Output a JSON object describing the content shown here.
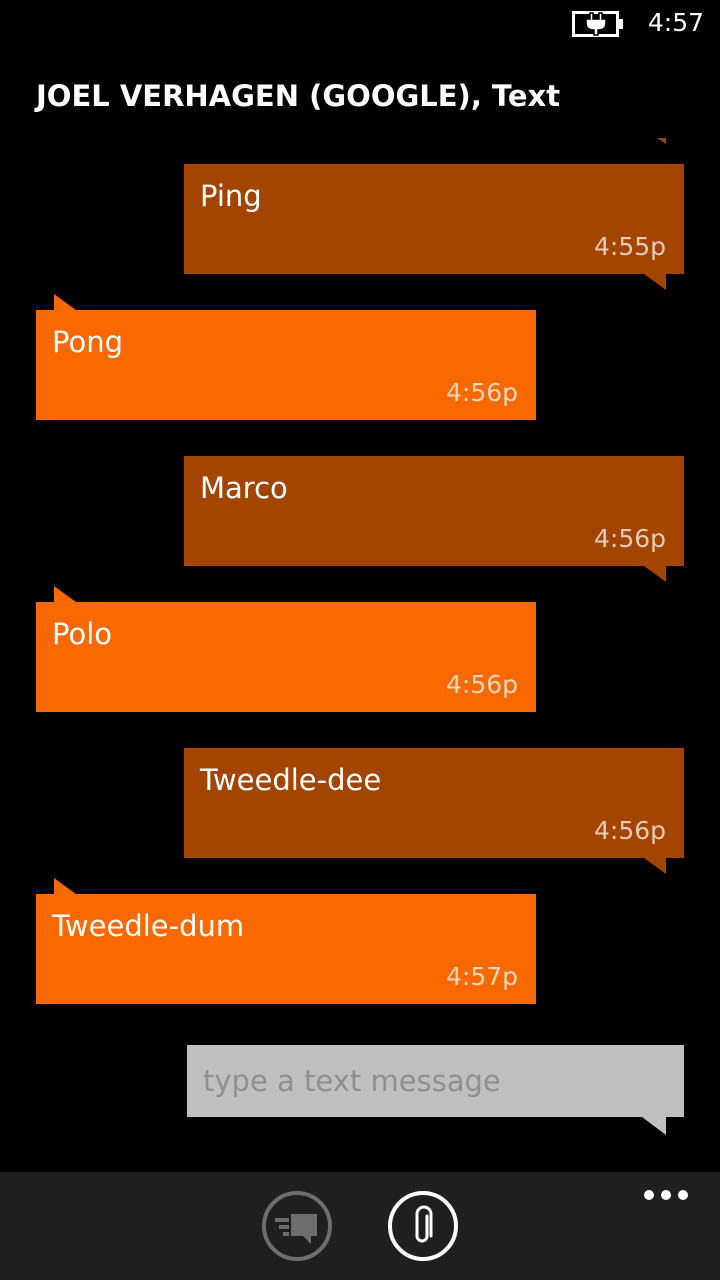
{
  "status_bar": {
    "time": "4:57",
    "battery_icon": "battery-charging-icon"
  },
  "header": {
    "title": "JOEL VERHAGEN (GOOGLE), Text"
  },
  "messages": [
    {
      "direction": "sent",
      "text": "Ping",
      "time": "4:55p"
    },
    {
      "direction": "received",
      "text": "Pong",
      "time": "4:56p"
    },
    {
      "direction": "sent",
      "text": "Marco",
      "time": "4:56p"
    },
    {
      "direction": "received",
      "text": "Polo",
      "time": "4:56p"
    },
    {
      "direction": "sent",
      "text": "Tweedle-dee",
      "time": "4:56p"
    },
    {
      "direction": "received",
      "text": "Tweedle-dum",
      "time": "4:57p"
    }
  ],
  "compose": {
    "placeholder": "type a text message",
    "value": ""
  },
  "app_bar": {
    "buttons": [
      {
        "icon": "switch-thread-icon",
        "state": "disabled"
      },
      {
        "icon": "paperclip-icon",
        "state": "enabled"
      }
    ],
    "more_icon": "ellipsis-icon"
  },
  "colors": {
    "sent_bubble": "#a34500",
    "received_bubble": "#fa6800",
    "compose_box": "#bfbfbf",
    "background": "#000000",
    "app_bar": "#1f1f1f"
  }
}
